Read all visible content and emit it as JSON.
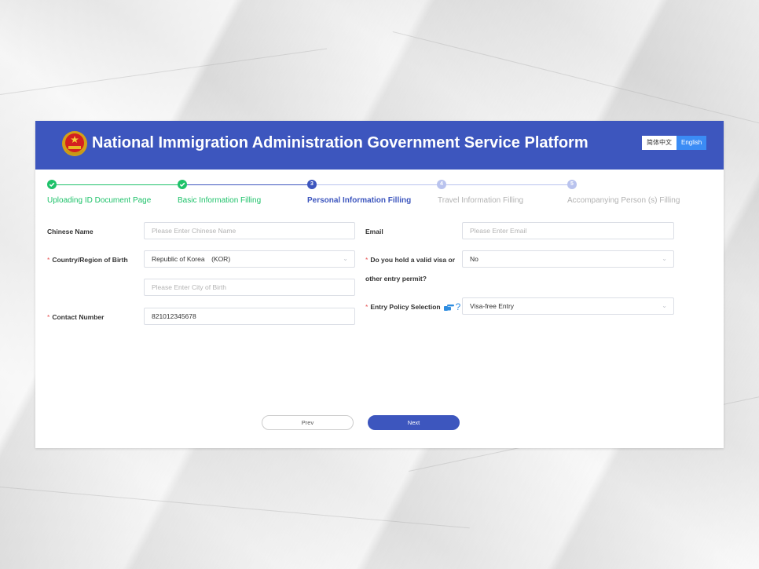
{
  "app": {
    "title": "National Immigration Administration Government Service Platform",
    "lang_cn": "简体中文",
    "lang_en": "English"
  },
  "steps": [
    {
      "label": "Uploading ID Document Page",
      "state": "done",
      "mark": ""
    },
    {
      "label": "Basic Information Filling",
      "state": "done",
      "mark": ""
    },
    {
      "label": "Personal Information Filling",
      "state": "active",
      "mark": "3"
    },
    {
      "label": "Travel Information Filling",
      "state": "pending",
      "mark": "4"
    },
    {
      "label": "Accompanying Person (s) Filling",
      "state": "pending",
      "mark": "5"
    }
  ],
  "form": {
    "chinese_name": {
      "label": "Chinese Name",
      "placeholder": "Please Enter Chinese Name"
    },
    "birth_country": {
      "required": "*",
      "label": "Country/Region of Birth",
      "value": "Republic of Korea　(KOR)"
    },
    "birth_city": {
      "placeholder": "Please Enter City of Birth"
    },
    "contact_number": {
      "required": "*",
      "label": "Contact Number",
      "value": "821012345678"
    },
    "email": {
      "label": "Email",
      "placeholder": "Please Enter Email"
    },
    "visa": {
      "required": "*",
      "label_line1": "Do you hold a valid visa or",
      "label_line2": "other entry permit?",
      "value": "No"
    },
    "entry_policy": {
      "required": "*",
      "label": "Entry Policy Selection",
      "help": "?",
      "value": "Visa-free Entry"
    }
  },
  "buttons": {
    "prev": "Prev",
    "next": "Next"
  },
  "colors": {
    "brand": "#3d56be",
    "done": "#1ec26a",
    "pending": "#b9c3ee",
    "required": "#e85454"
  },
  "icons": {
    "done": "check-icon",
    "emblem": "national-emblem-icon",
    "pointer": "pointing-hand-icon",
    "dropdown": "chevron-down-icon"
  }
}
